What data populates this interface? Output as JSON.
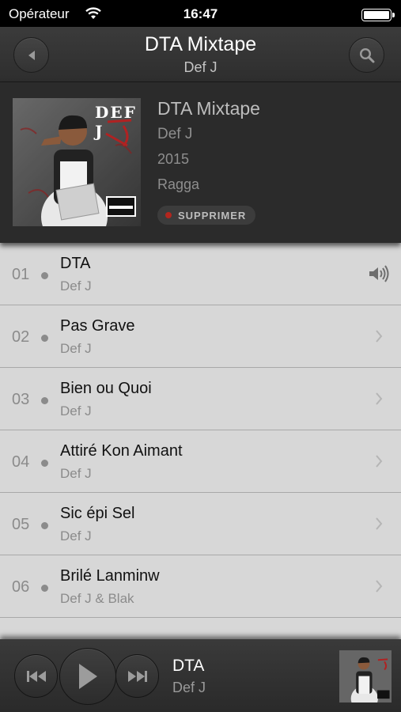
{
  "status_bar": {
    "carrier": "Opérateur",
    "time": "16:47"
  },
  "nav": {
    "title": "DTA Mixtape",
    "subtitle": "Def J"
  },
  "album": {
    "title": "DTA Mixtape",
    "artist": "Def J",
    "year": "2015",
    "genre": "Ragga",
    "delete_label": "SUPPRIMER",
    "cover_text": "DEF J"
  },
  "tracks": [
    {
      "number": "01",
      "title": "DTA",
      "artist": "Def J",
      "accessory": "speaker-icon"
    },
    {
      "number": "02",
      "title": "Pas Grave",
      "artist": "Def J",
      "accessory": "chevron-right-icon"
    },
    {
      "number": "03",
      "title": "Bien ou Quoi",
      "artist": "Def J",
      "accessory": "chevron-right-icon"
    },
    {
      "number": "04",
      "title": "Attiré Kon Aimant",
      "artist": "Def J",
      "accessory": "chevron-right-icon"
    },
    {
      "number": "05",
      "title": "Sic épi Sel",
      "artist": "Def J",
      "accessory": "chevron-right-icon"
    },
    {
      "number": "06",
      "title": "Brilé Lanminw",
      "artist": "Def J & Blak",
      "accessory": "chevron-right-icon"
    }
  ],
  "player": {
    "title": "DTA",
    "artist": "Def J"
  },
  "colors": {
    "delete_dot": "#b3261e",
    "list_background": "#d7d7d7",
    "header_background": "#2b2b2b"
  }
}
